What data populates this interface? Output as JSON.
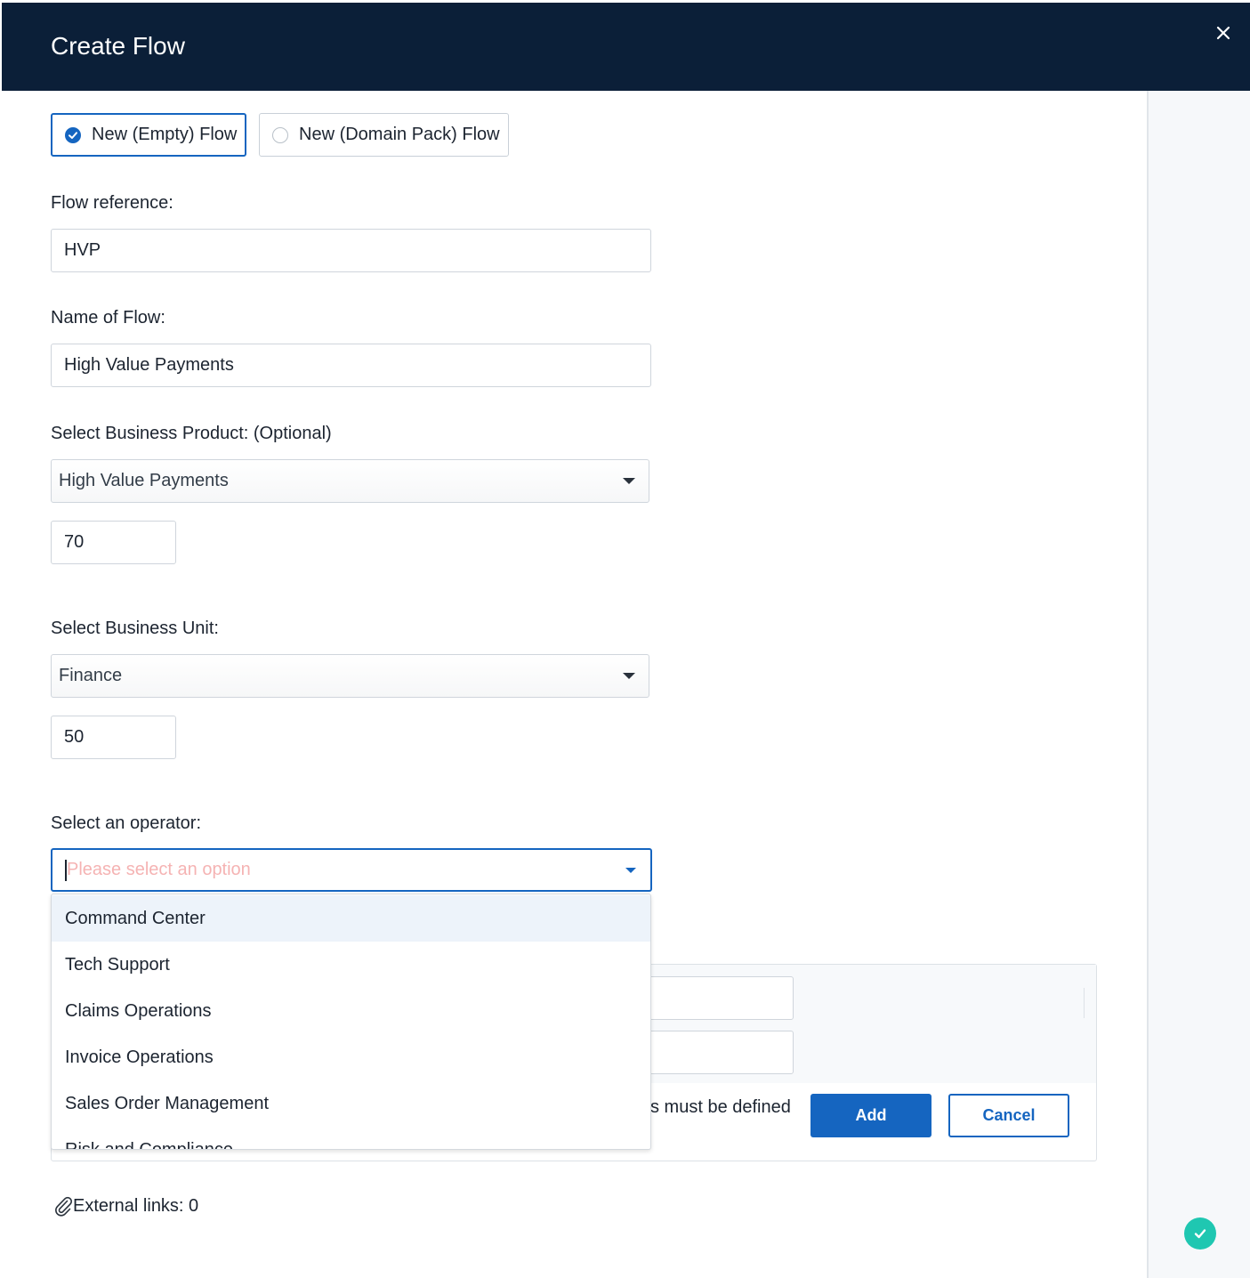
{
  "dialog": {
    "title": "Create Flow"
  },
  "flow_type": {
    "empty_label": "New (Empty) Flow",
    "domain_pack_label": "New (Domain Pack) Flow"
  },
  "flow_reference": {
    "label": "Flow reference:",
    "value": "HVP"
  },
  "flow_name": {
    "label": "Name of Flow:",
    "value": "High Value Payments"
  },
  "business_product": {
    "label": "Select Business Product: (Optional)",
    "selected": "High Value Payments",
    "number_value": "70"
  },
  "business_unit": {
    "label": "Select Business Unit:",
    "selected": "Finance",
    "number_value": "50"
  },
  "operator": {
    "label": "Select an operator:",
    "placeholder": "Please select an option",
    "options": [
      "Command Center",
      "Tech Support",
      "Claims Operations",
      "Invoice Operations",
      "Sales Order Management",
      "Risk and Compliance"
    ]
  },
  "behind_panel": {
    "message_fragment": "s must be defined",
    "add_label": "Add",
    "cancel_label": "Cancel"
  },
  "footer": {
    "external_links": "External links: 0"
  },
  "colors": {
    "header_bg": "#0b1f38",
    "primary": "#1565c0",
    "success": "#1fc7b1",
    "placeholder": "#f5b3b3"
  }
}
